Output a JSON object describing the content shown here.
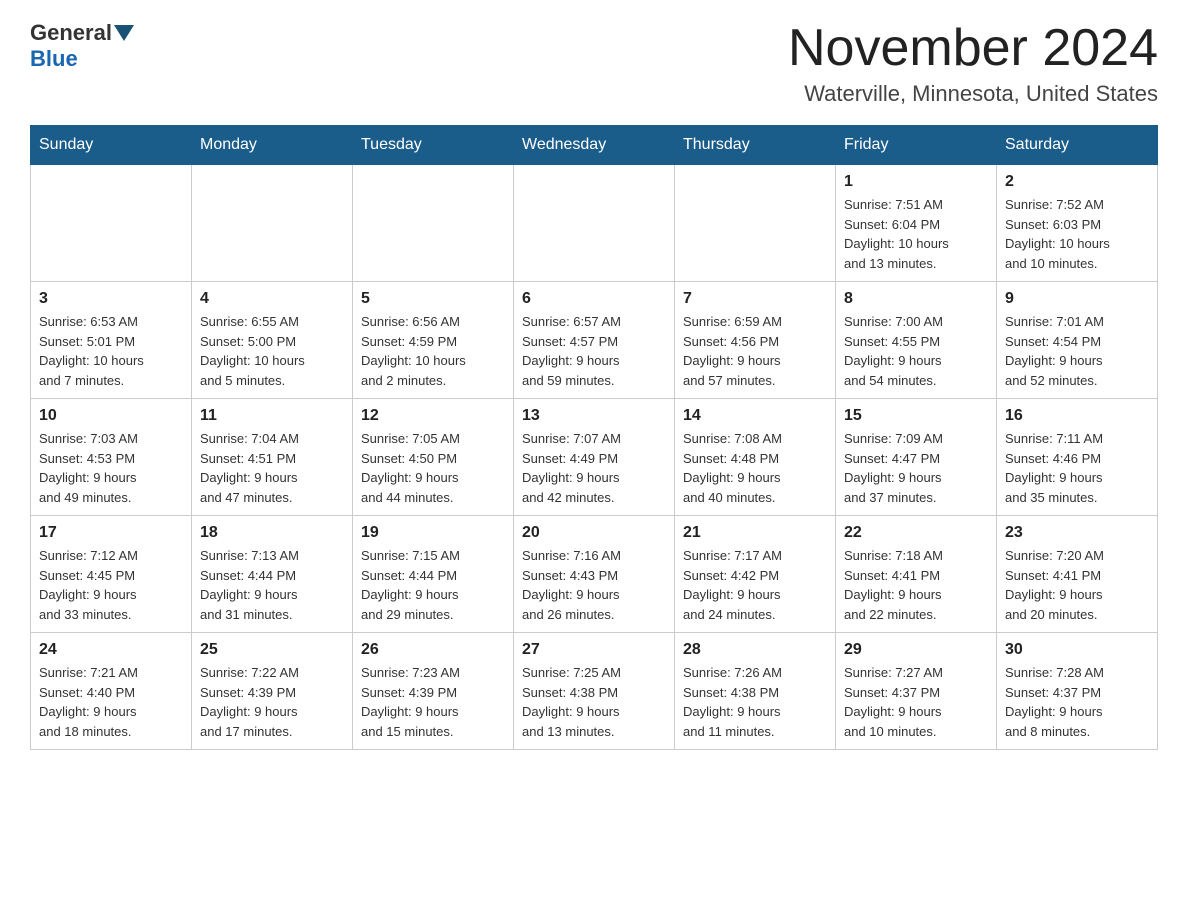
{
  "header": {
    "logo_general": "General",
    "logo_blue": "Blue",
    "month_title": "November 2024",
    "location": "Waterville, Minnesota, United States"
  },
  "weekdays": [
    "Sunday",
    "Monday",
    "Tuesday",
    "Wednesday",
    "Thursday",
    "Friday",
    "Saturday"
  ],
  "weeks": [
    [
      {
        "day": "",
        "info": ""
      },
      {
        "day": "",
        "info": ""
      },
      {
        "day": "",
        "info": ""
      },
      {
        "day": "",
        "info": ""
      },
      {
        "day": "",
        "info": ""
      },
      {
        "day": "1",
        "info": "Sunrise: 7:51 AM\nSunset: 6:04 PM\nDaylight: 10 hours\nand 13 minutes."
      },
      {
        "day": "2",
        "info": "Sunrise: 7:52 AM\nSunset: 6:03 PM\nDaylight: 10 hours\nand 10 minutes."
      }
    ],
    [
      {
        "day": "3",
        "info": "Sunrise: 6:53 AM\nSunset: 5:01 PM\nDaylight: 10 hours\nand 7 minutes."
      },
      {
        "day": "4",
        "info": "Sunrise: 6:55 AM\nSunset: 5:00 PM\nDaylight: 10 hours\nand 5 minutes."
      },
      {
        "day": "5",
        "info": "Sunrise: 6:56 AM\nSunset: 4:59 PM\nDaylight: 10 hours\nand 2 minutes."
      },
      {
        "day": "6",
        "info": "Sunrise: 6:57 AM\nSunset: 4:57 PM\nDaylight: 9 hours\nand 59 minutes."
      },
      {
        "day": "7",
        "info": "Sunrise: 6:59 AM\nSunset: 4:56 PM\nDaylight: 9 hours\nand 57 minutes."
      },
      {
        "day": "8",
        "info": "Sunrise: 7:00 AM\nSunset: 4:55 PM\nDaylight: 9 hours\nand 54 minutes."
      },
      {
        "day": "9",
        "info": "Sunrise: 7:01 AM\nSunset: 4:54 PM\nDaylight: 9 hours\nand 52 minutes."
      }
    ],
    [
      {
        "day": "10",
        "info": "Sunrise: 7:03 AM\nSunset: 4:53 PM\nDaylight: 9 hours\nand 49 minutes."
      },
      {
        "day": "11",
        "info": "Sunrise: 7:04 AM\nSunset: 4:51 PM\nDaylight: 9 hours\nand 47 minutes."
      },
      {
        "day": "12",
        "info": "Sunrise: 7:05 AM\nSunset: 4:50 PM\nDaylight: 9 hours\nand 44 minutes."
      },
      {
        "day": "13",
        "info": "Sunrise: 7:07 AM\nSunset: 4:49 PM\nDaylight: 9 hours\nand 42 minutes."
      },
      {
        "day": "14",
        "info": "Sunrise: 7:08 AM\nSunset: 4:48 PM\nDaylight: 9 hours\nand 40 minutes."
      },
      {
        "day": "15",
        "info": "Sunrise: 7:09 AM\nSunset: 4:47 PM\nDaylight: 9 hours\nand 37 minutes."
      },
      {
        "day": "16",
        "info": "Sunrise: 7:11 AM\nSunset: 4:46 PM\nDaylight: 9 hours\nand 35 minutes."
      }
    ],
    [
      {
        "day": "17",
        "info": "Sunrise: 7:12 AM\nSunset: 4:45 PM\nDaylight: 9 hours\nand 33 minutes."
      },
      {
        "day": "18",
        "info": "Sunrise: 7:13 AM\nSunset: 4:44 PM\nDaylight: 9 hours\nand 31 minutes."
      },
      {
        "day": "19",
        "info": "Sunrise: 7:15 AM\nSunset: 4:44 PM\nDaylight: 9 hours\nand 29 minutes."
      },
      {
        "day": "20",
        "info": "Sunrise: 7:16 AM\nSunset: 4:43 PM\nDaylight: 9 hours\nand 26 minutes."
      },
      {
        "day": "21",
        "info": "Sunrise: 7:17 AM\nSunset: 4:42 PM\nDaylight: 9 hours\nand 24 minutes."
      },
      {
        "day": "22",
        "info": "Sunrise: 7:18 AM\nSunset: 4:41 PM\nDaylight: 9 hours\nand 22 minutes."
      },
      {
        "day": "23",
        "info": "Sunrise: 7:20 AM\nSunset: 4:41 PM\nDaylight: 9 hours\nand 20 minutes."
      }
    ],
    [
      {
        "day": "24",
        "info": "Sunrise: 7:21 AM\nSunset: 4:40 PM\nDaylight: 9 hours\nand 18 minutes."
      },
      {
        "day": "25",
        "info": "Sunrise: 7:22 AM\nSunset: 4:39 PM\nDaylight: 9 hours\nand 17 minutes."
      },
      {
        "day": "26",
        "info": "Sunrise: 7:23 AM\nSunset: 4:39 PM\nDaylight: 9 hours\nand 15 minutes."
      },
      {
        "day": "27",
        "info": "Sunrise: 7:25 AM\nSunset: 4:38 PM\nDaylight: 9 hours\nand 13 minutes."
      },
      {
        "day": "28",
        "info": "Sunrise: 7:26 AM\nSunset: 4:38 PM\nDaylight: 9 hours\nand 11 minutes."
      },
      {
        "day": "29",
        "info": "Sunrise: 7:27 AM\nSunset: 4:37 PM\nDaylight: 9 hours\nand 10 minutes."
      },
      {
        "day": "30",
        "info": "Sunrise: 7:28 AM\nSunset: 4:37 PM\nDaylight: 9 hours\nand 8 minutes."
      }
    ]
  ]
}
